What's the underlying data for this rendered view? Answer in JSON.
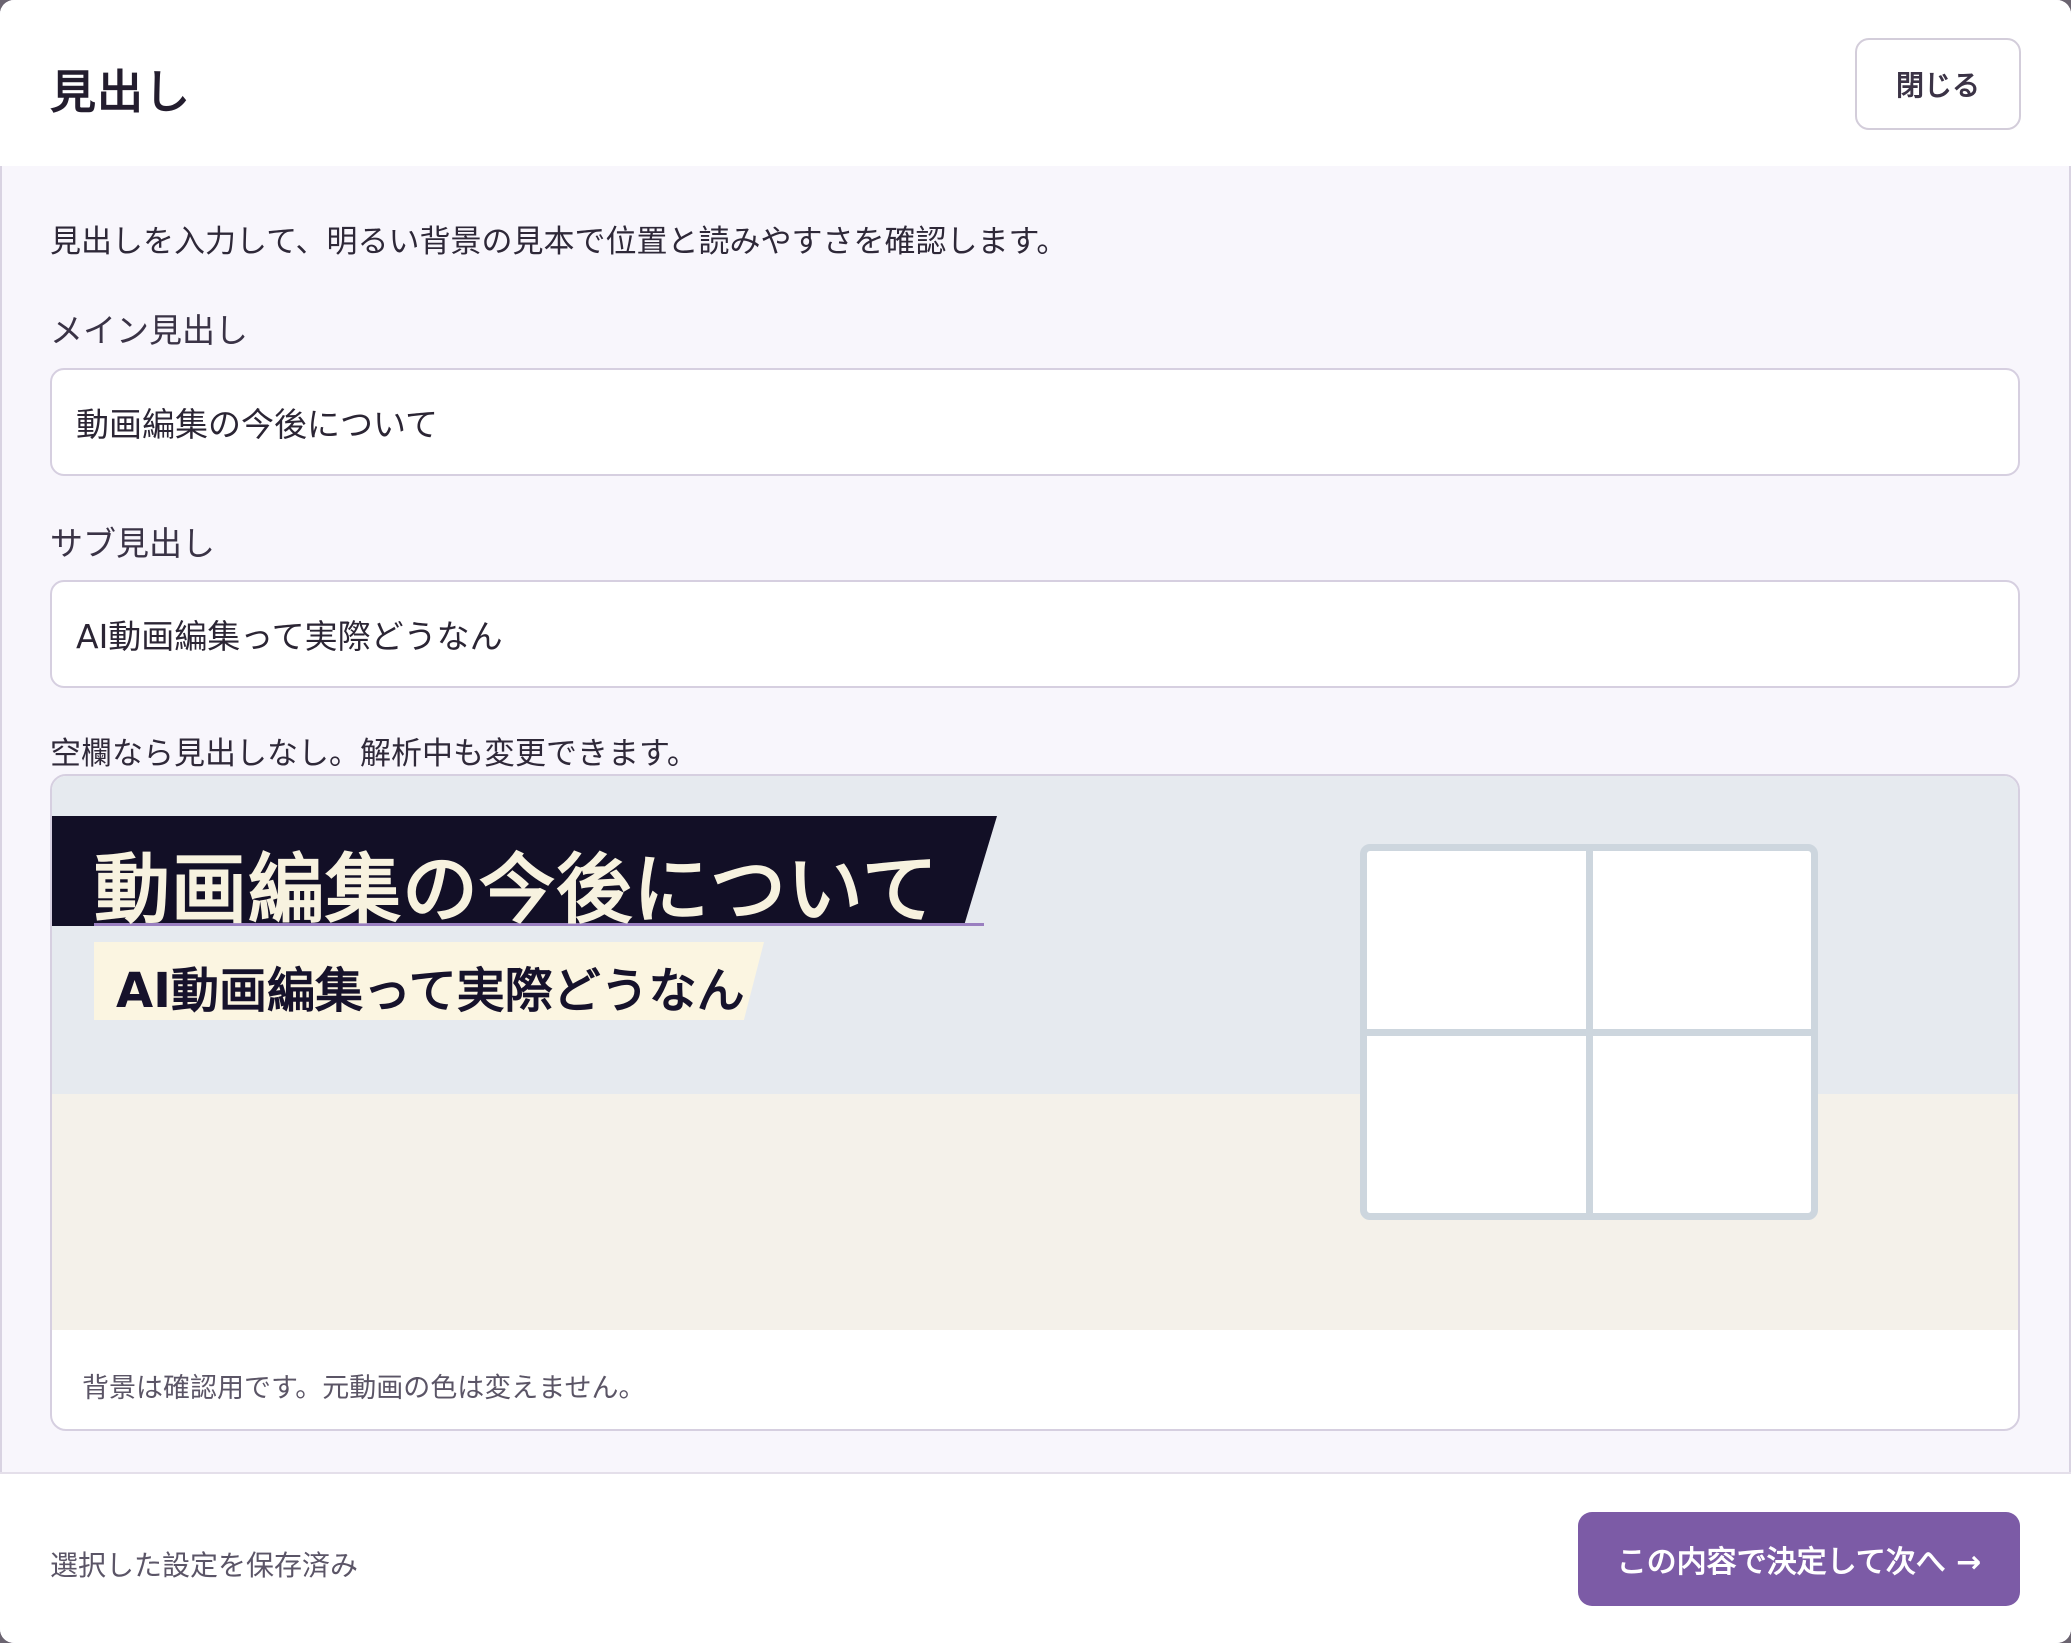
{
  "header": {
    "title": "見出し",
    "close_label": "閉じる"
  },
  "body": {
    "description": "見出しを入力して、明るい背景の見本で位置と読みやすさを確認します。",
    "main_heading": {
      "label": "メイン見出し",
      "value": "動画編集の今後について"
    },
    "sub_heading": {
      "label": "サブ見出し",
      "value": "AI動画編集って実際どうなん"
    },
    "hint": "空欄なら見出しなし。解析中も変更できます。"
  },
  "preview": {
    "main_text": "動画編集の今後について",
    "sub_text": "AI動画編集って実際どうなん",
    "note": "背景は確認用です。元動画の色は変えません。",
    "window_icon": "window-illustration-icon"
  },
  "footer": {
    "status": "選択した設定を保存済み",
    "next_label": "この内容で決定して次へ →"
  },
  "colors": {
    "accent": "#7c5ba6",
    "heading_band": "#120f26",
    "heading_text": "#f7f2df",
    "subheading_band": "#fbf5e1",
    "preview_top": "#e6eaef",
    "preview_bottom": "#f4f1ea"
  }
}
